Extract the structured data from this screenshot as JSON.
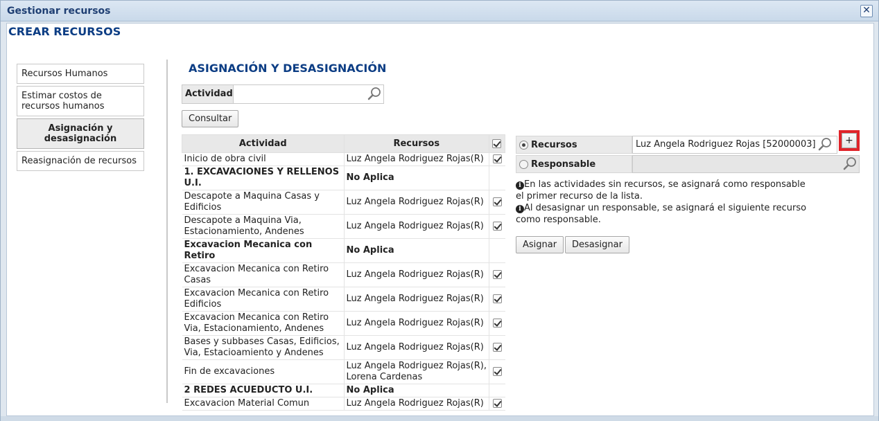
{
  "window": {
    "title": "Gestionar recursos",
    "close_icon": "close-icon"
  },
  "page": {
    "title": "CREAR RECURSOS"
  },
  "sidebar": {
    "items": [
      {
        "label": "Recursos Humanos"
      },
      {
        "label": "Estimar costos de recursos humanos"
      },
      {
        "label": "Asignación y desasignación",
        "active": true
      },
      {
        "label": "Reasignación de recursos"
      }
    ]
  },
  "section": {
    "title": "ASIGNACIÓN Y DESASIGNACIÓN"
  },
  "filter": {
    "label": "Actividad",
    "value": "",
    "search_icon": "search-icon"
  },
  "buttons": {
    "consultar": "Consultar",
    "asignar": "Asignar",
    "desasignar": "Desasignar",
    "plus": "+"
  },
  "table": {
    "headers": {
      "actividad": "Actividad",
      "recursos": "Recursos"
    },
    "rows": [
      {
        "actividad": "Inicio de obra civil",
        "recursos": "Luz Angela Rodriguez Rojas(R)",
        "checked": true,
        "group": false
      },
      {
        "actividad": "1. EXCAVACIONES Y RELLENOS U.I.",
        "recursos": "No Aplica",
        "checked": false,
        "group": true
      },
      {
        "actividad": "Descapote a Maquina Casas y Edificios",
        "recursos": "Luz Angela Rodriguez Rojas(R)",
        "checked": true,
        "group": false
      },
      {
        "actividad": "Descapote a Maquina Via, Estacionamiento, Andenes",
        "recursos": "Luz Angela Rodriguez Rojas(R)",
        "checked": true,
        "group": false
      },
      {
        "actividad": "Excavacion Mecanica con Retiro",
        "recursos": "No Aplica",
        "checked": false,
        "group": true
      },
      {
        "actividad": "Excavacion Mecanica con Retiro Casas",
        "recursos": "Luz Angela Rodriguez Rojas(R)",
        "checked": true,
        "group": false
      },
      {
        "actividad": "Excavacion Mecanica con Retiro Edificios",
        "recursos": "Luz Angela Rodriguez Rojas(R)",
        "checked": true,
        "group": false
      },
      {
        "actividad": "Excavacion Mecanica con Retiro Via, Estacionamiento, Andenes",
        "recursos": "Luz Angela Rodriguez Rojas(R)",
        "checked": true,
        "group": false
      },
      {
        "actividad": "Bases y subbases Casas, Edificios, Via, Estacioamiento y Andenes",
        "recursos": "Luz Angela Rodriguez Rojas(R)",
        "checked": true,
        "group": false
      },
      {
        "actividad": "Fin de excavaciones",
        "recursos": "Luz Angela Rodriguez Rojas(R), Lorena Cardenas",
        "checked": true,
        "group": false
      },
      {
        "actividad": "2 REDES ACUEDUCTO U.I.",
        "recursos": "No Aplica",
        "checked": false,
        "group": true
      },
      {
        "actividad": "Excavacion Material Comun",
        "recursos": "Luz Angela Rodriguez Rojas(R)",
        "checked": true,
        "group": false
      }
    ]
  },
  "assign": {
    "recursos_label": "Recursos",
    "recursos_value": "Luz Angela Rodriguez Rojas [52000003]",
    "responsable_label": "Responsable",
    "responsable_value": "",
    "selected": "recursos",
    "note1": "En las actividades sin recursos, se asignará como responsable el primer recurso de la lista.",
    "note2": "Al desasignar un responsable, se asignará el siguiente recurso como responsable."
  }
}
